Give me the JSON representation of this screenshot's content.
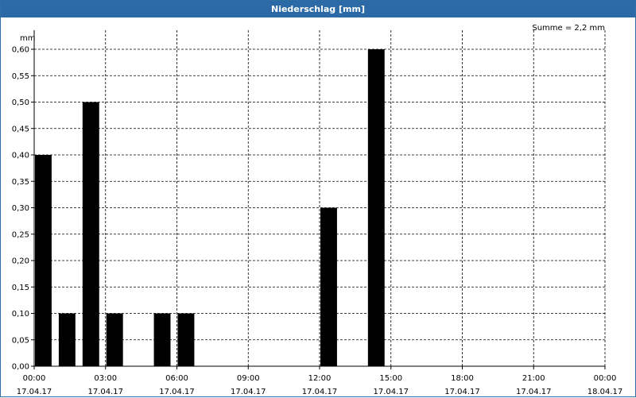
{
  "window": {
    "title": "Niederschlag [mm]"
  },
  "chart_data": {
    "type": "bar",
    "title": "Niederschlag [mm]",
    "ylabel": "mm",
    "annotation": "Summe = 2,2 mm",
    "ylim": [
      0,
      0.6
    ],
    "xlim_hours": [
      0,
      24
    ],
    "grid": true,
    "yticks": [
      "0,00",
      "0,05",
      "0,10",
      "0,15",
      "0,20",
      "0,25",
      "0,30",
      "0,35",
      "0,40",
      "0,45",
      "0,50",
      "0,55",
      "0,60"
    ],
    "xticks": [
      {
        "time": "00:00",
        "date": "17.04.17"
      },
      {
        "time": "03:00",
        "date": "17.04.17"
      },
      {
        "time": "06:00",
        "date": "17.04.17"
      },
      {
        "time": "09:00",
        "date": "17.04.17"
      },
      {
        "time": "12:00",
        "date": "17.04.17"
      },
      {
        "time": "15:00",
        "date": "17.04.17"
      },
      {
        "time": "18:00",
        "date": "17.04.17"
      },
      {
        "time": "21:00",
        "date": "17.04.17"
      },
      {
        "time": "00:00",
        "date": "18.04.17"
      }
    ],
    "x": [
      "00:00",
      "01:00",
      "02:00",
      "03:00",
      "05:00",
      "06:00",
      "12:00",
      "14:00"
    ],
    "values": [
      0.4,
      0.1,
      0.5,
      0.1,
      0.1,
      0.1,
      0.3,
      0.6
    ],
    "bar_color": "#000000"
  }
}
